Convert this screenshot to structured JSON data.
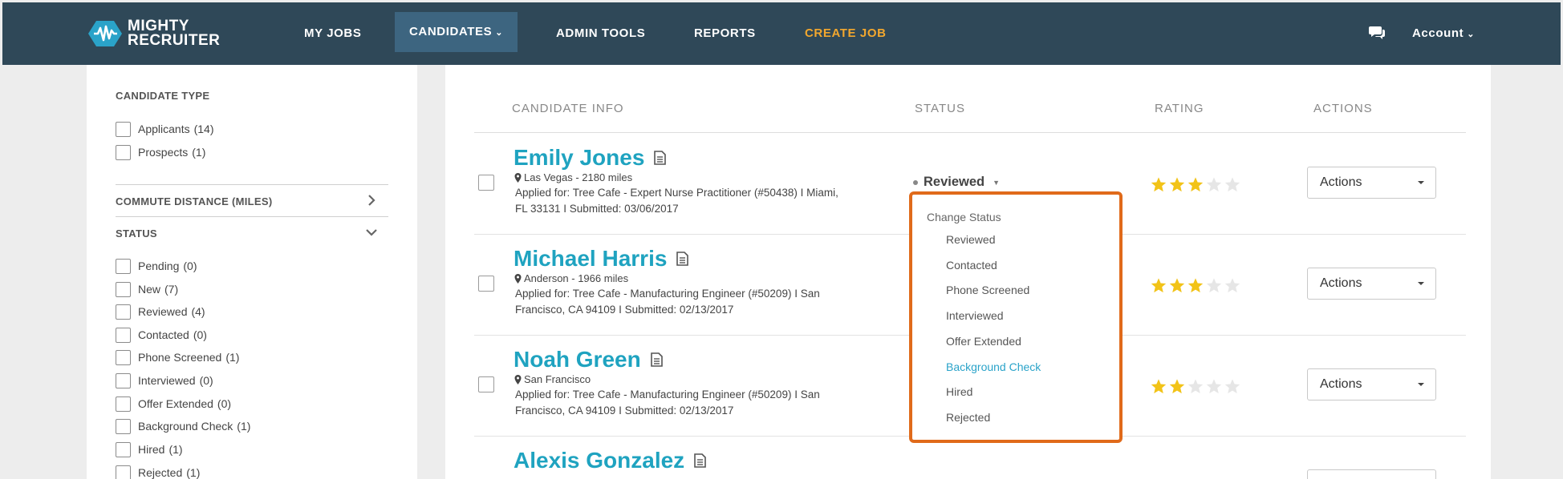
{
  "nav": {
    "logo_line1": "MIGHTY",
    "logo_line2": "RECRUITER",
    "items": [
      "MY JOBS",
      "CANDIDATES",
      "ADMIN TOOLS",
      "REPORTS",
      "CREATE JOB"
    ],
    "account": "Account",
    "accent_color": "#f2a72e",
    "bg_color": "#2f4858"
  },
  "sidebar": {
    "candidate_type_title": "CANDIDATE TYPE",
    "candidate_types": [
      {
        "label": "Applicants",
        "count": "(14)"
      },
      {
        "label": "Prospects",
        "count": "(1)"
      }
    ],
    "commute_title": "COMMUTE DISTANCE (MILES)",
    "status_title": "STATUS",
    "statuses": [
      {
        "label": "Pending",
        "count": "(0)"
      },
      {
        "label": "New",
        "count": "(7)"
      },
      {
        "label": "Reviewed",
        "count": "(4)"
      },
      {
        "label": "Contacted",
        "count": "(0)"
      },
      {
        "label": "Phone Screened",
        "count": "(1)"
      },
      {
        "label": "Interviewed",
        "count": "(0)"
      },
      {
        "label": "Offer Extended",
        "count": "(0)"
      },
      {
        "label": "Background Check",
        "count": "(1)"
      },
      {
        "label": "Hired",
        "count": "(1)"
      },
      {
        "label": "Rejected",
        "count": "(1)"
      }
    ]
  },
  "table": {
    "headers": [
      "CANDIDATE INFO",
      "STATUS",
      "RATING",
      "ACTIONS"
    ],
    "actions_label": "Actions",
    "current_status": "Reviewed",
    "candidates": [
      {
        "name": "Emily Jones",
        "location": "Las Vegas - 2180 miles",
        "applied_1": "Applied for: Tree Cafe - Expert Nurse Practitioner (#50438)  I  Miami,",
        "applied_2": "FL 33131  I  Submitted: 03/06/2017",
        "rating": 3
      },
      {
        "name": "Michael Harris",
        "location": "Anderson - 1966 miles",
        "applied_1": "Applied for: Tree Cafe - Manufacturing Engineer (#50209)  I  San",
        "applied_2": "Francisco, CA 94109  I  Submitted: 02/13/2017",
        "rating": 3
      },
      {
        "name": "Noah Green",
        "location": "San Francisco",
        "applied_1": "Applied for: Tree Cafe - Manufacturing Engineer (#50209)  I  San",
        "applied_2": "Francisco, CA 94109  I  Submitted: 02/13/2017",
        "rating": 2
      },
      {
        "name": "Alexis Gonzalez"
      }
    ]
  },
  "dropdown": {
    "title": "Change Status",
    "items": [
      "Reviewed",
      "Contacted",
      "Phone Screened",
      "Interviewed",
      "Offer Extended",
      "Background Check",
      "Hired",
      "Rejected"
    ],
    "highlighted": "Background Check",
    "highlight_color": "#2aa3c9",
    "border_color": "#e06a1a"
  },
  "star_color": "#f2c318"
}
